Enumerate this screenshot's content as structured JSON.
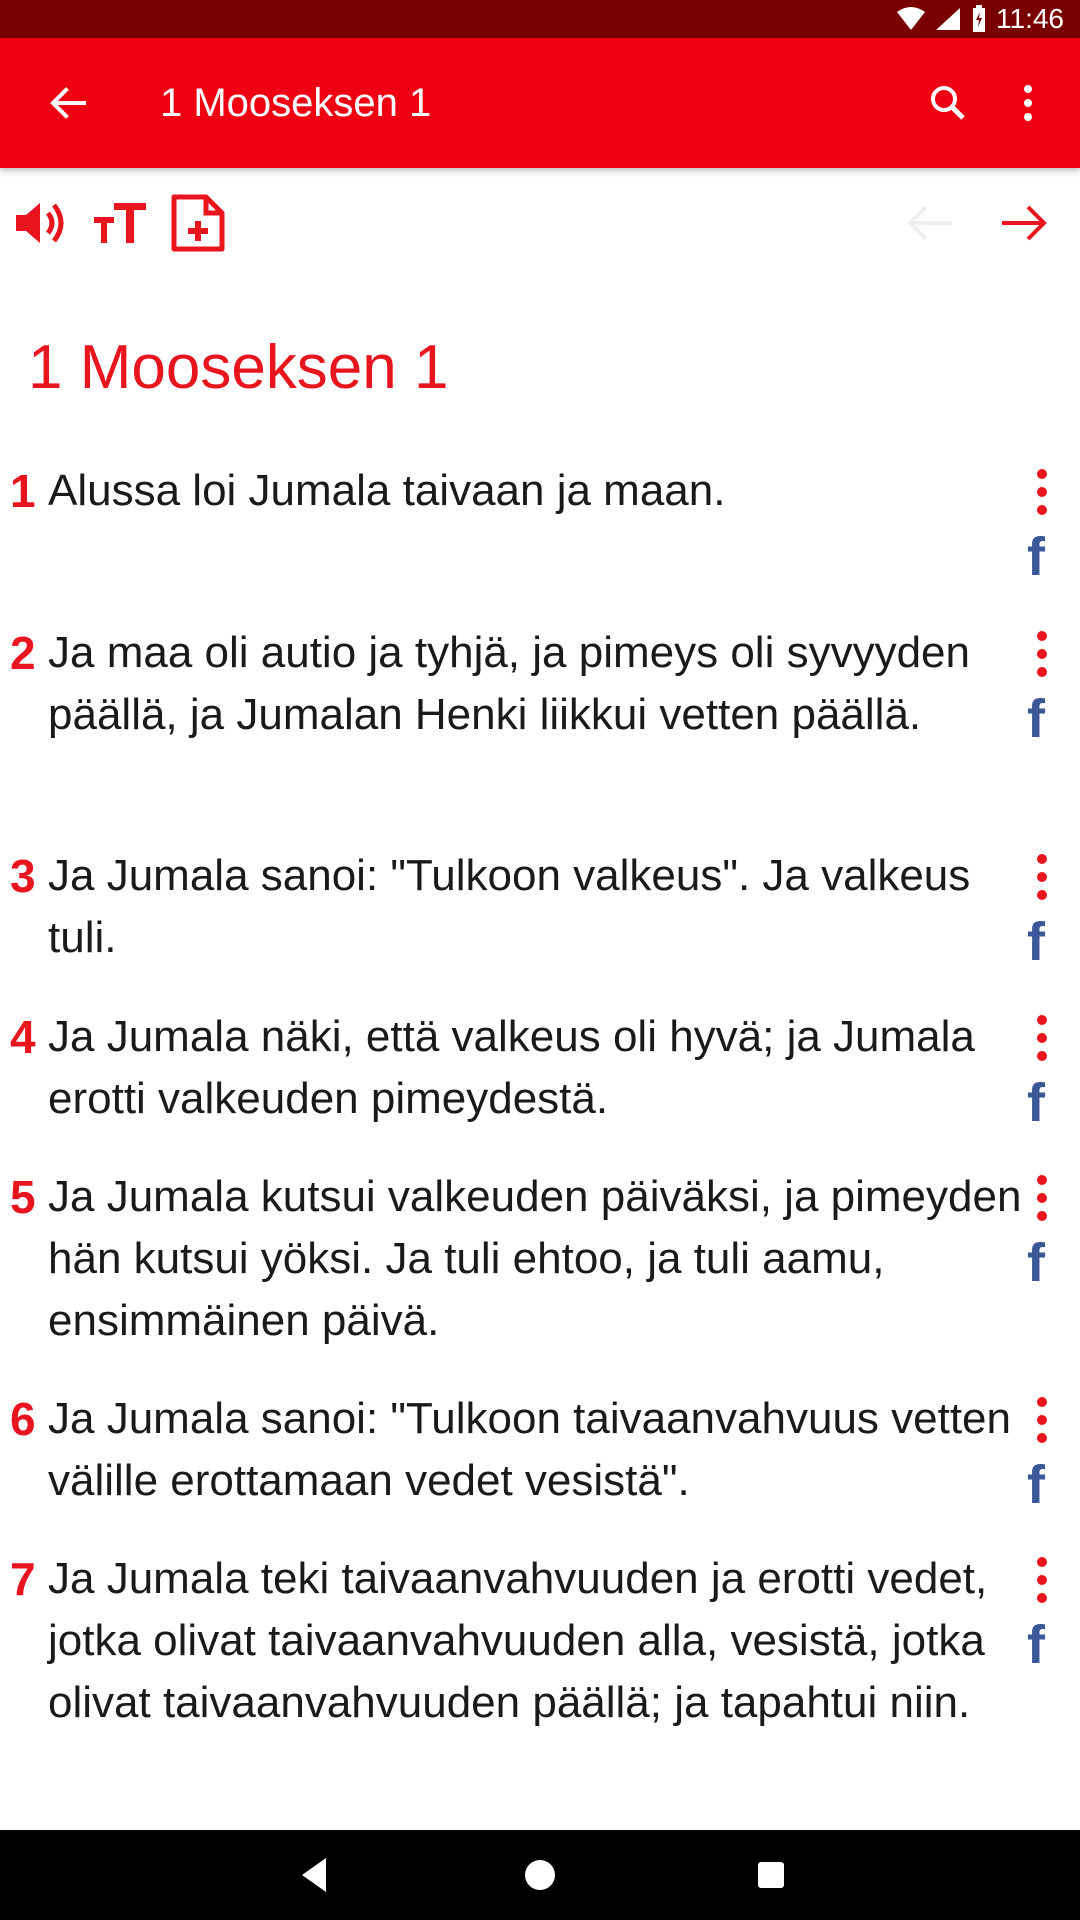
{
  "status_bar": {
    "time": "11:46",
    "icons": [
      "wifi-icon",
      "signal-icon",
      "battery-icon"
    ]
  },
  "app_bar": {
    "title": "1 Mooseksen 1",
    "back_icon": "arrow-back-icon",
    "search_icon": "search-icon",
    "more_icon": "more-vert-icon",
    "color": "#ee0012"
  },
  "toolbar": {
    "icons": [
      "volume-icon",
      "text-size-icon",
      "add-note-icon"
    ],
    "prev_icon": "arrow-left-icon",
    "next_icon": "arrow-right-icon"
  },
  "chapter": {
    "title": "1 Mooseksen 1",
    "accent_color": "#e8141e",
    "verses": [
      {
        "num": "1",
        "text": "Alussa loi Jumala taivaan ja maan."
      },
      {
        "num": "2",
        "text": "Ja maa oli autio ja tyhjä, ja pimeys oli syvyyden päällä, ja Jumalan Henki liikkui vetten päällä."
      },
      {
        "num": "3",
        "text": "Ja Jumala sanoi: \"Tulkoon valkeus\". Ja valkeus tuli."
      },
      {
        "num": "4",
        "text": "Ja Jumala näki, että valkeus oli hyvä; ja Jumala erotti valkeuden pimeydestä."
      },
      {
        "num": "5",
        "text": "Ja Jumala kutsui valkeuden päiväksi, ja pimeyden hän kutsui yöksi. Ja tuli ehtoo, ja tuli aamu, ensimmäinen päivä."
      },
      {
        "num": "6",
        "text": "Ja Jumala sanoi: \"Tulkoon taivaanvahvuus vetten välille erottamaan vedet vesistä\"."
      },
      {
        "num": "7",
        "text": "Ja Jumala teki taivaanvahvuuden ja erotti vedet, jotka olivat taivaanvahvuuden alla, vesistä, jotka olivat taivaanvahvuuden päällä; ja tapahtui niin."
      }
    ],
    "share_label": "f",
    "share_color": "#3b5998"
  },
  "nav_bar": {
    "icons": [
      "nav-back-icon",
      "nav-home-icon",
      "nav-recents-icon"
    ]
  }
}
